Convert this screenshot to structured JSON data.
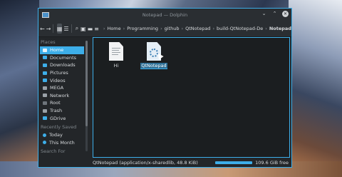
{
  "window": {
    "title": "Notepad — Dolphin"
  },
  "breadcrumb": [
    "Home",
    "Programming",
    "github",
    "QtNotepad",
    "build-QtNotepad-De",
    "Notepad"
  ],
  "sidebar": {
    "places_title": "Places",
    "places": [
      {
        "label": "Home",
        "icon": "home-icon"
      },
      {
        "label": "Documents",
        "icon": "documents-icon"
      },
      {
        "label": "Downloads",
        "icon": "downloads-icon"
      },
      {
        "label": "Pictures",
        "icon": "pictures-icon"
      },
      {
        "label": "Videos",
        "icon": "videos-icon"
      },
      {
        "label": "MEGA",
        "icon": "mega-icon"
      },
      {
        "label": "Network",
        "icon": "network-icon"
      },
      {
        "label": "Root",
        "icon": "root-icon"
      },
      {
        "label": "Trash",
        "icon": "trash-icon"
      },
      {
        "label": "GDrive",
        "icon": "gdrive-icon"
      }
    ],
    "recent_title": "Recently Saved",
    "recent": [
      {
        "label": "Today"
      },
      {
        "label": "This Month"
      }
    ],
    "search_title": "Search For"
  },
  "files": [
    {
      "name": "Hi",
      "type": "text"
    },
    {
      "name": "QtNotepad",
      "type": "sharedlib"
    }
  ],
  "status": {
    "text": "QtNotepad (application/x-sharedlib, 48.8 KiB)",
    "free": "109.6 GiB free"
  }
}
